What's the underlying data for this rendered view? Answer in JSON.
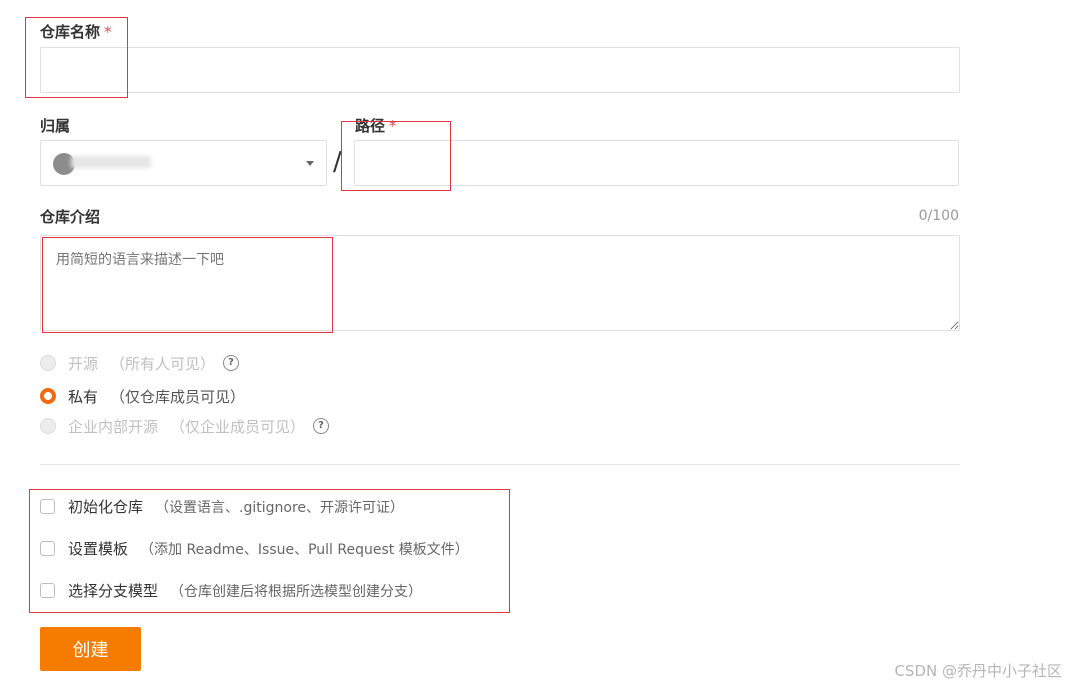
{
  "form": {
    "repo_name_label": "仓库名称",
    "required_mark": "*",
    "owner_label": "归属",
    "path_label": "路径",
    "separator": "/",
    "intro_label": "仓库介绍",
    "intro_counter": "0/100",
    "intro_placeholder": "用简短的语言来描述一下吧"
  },
  "visibility": {
    "options": [
      {
        "label": "开源",
        "hint": "（所有人可见）",
        "help": "?",
        "state": "disabled"
      },
      {
        "label": "私有",
        "hint": "（仅仓库成员可见）",
        "state": "selected"
      },
      {
        "label": "企业内部开源",
        "hint": "（仅企业成员可见）",
        "help": "?",
        "state": "disabled"
      }
    ]
  },
  "options": {
    "items": [
      {
        "label": "初始化仓库",
        "hint": "（设置语言、.gitignore、开源许可证）"
      },
      {
        "label": "设置模板",
        "hint": "（添加 Readme、Issue、Pull Request 模板文件）"
      },
      {
        "label": "选择分支模型",
        "hint": "（仓库创建后将根据所选模型创建分支）"
      }
    ]
  },
  "actions": {
    "create_label": "创建"
  },
  "watermark": "CSDN @乔丹中小子社区",
  "colors": {
    "accent": "#f57c00",
    "annotation": "#e0363f",
    "required": "#e34d4d"
  }
}
